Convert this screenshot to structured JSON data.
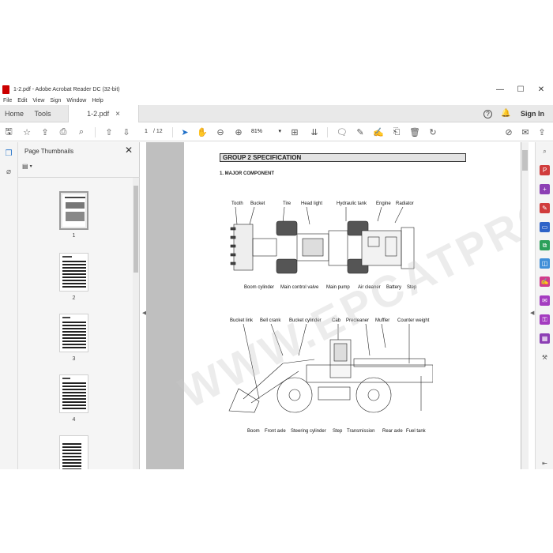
{
  "window": {
    "title": "1-2.pdf - Adobe Acrobat Reader DC (32-bit)",
    "controls": [
      "—",
      "☐",
      "✕"
    ]
  },
  "menu": [
    "File",
    "Edit",
    "View",
    "Sign",
    "Window",
    "Help"
  ],
  "tabs": {
    "home": "Home",
    "tools": "Tools",
    "document": "1-2.pdf",
    "sign_in": "Sign In"
  },
  "toolbar": {
    "current_page": "1",
    "total_pages": "/ 12",
    "zoom": "81%",
    "zoom_arrow": "▾"
  },
  "thumbnails_panel": {
    "title": "Page Thumbnails",
    "pages": [
      "1",
      "2",
      "3",
      "4"
    ]
  },
  "document": {
    "section_header": "GROUP 2  SPECIFICATION",
    "subsection": "1. MAJOR COMPONENT",
    "top_labels_upper": [
      "Tooth",
      "Bucket",
      "Tire",
      "Head light",
      "Hydraulic tank",
      "Engine",
      "Radiator"
    ],
    "top_labels_lower": [
      "Boom cylinder",
      "Main control valve",
      "Main pump",
      "Air cleaner",
      "Battery",
      "Step"
    ],
    "side_labels_upper": [
      "Bucket link",
      "Bell crank",
      "Bucket cylinder",
      "Cab",
      "Precleaner",
      "Muffler",
      "Counter weight"
    ],
    "side_labels_lower": [
      "Boom",
      "Front axle",
      "Steering cylinder",
      "Step",
      "Transmission",
      "Rear axle",
      "Fuel tank"
    ],
    "watermark": "WWW.EPCATPRO.COM"
  },
  "colors": {
    "accent": "#1e6fc8",
    "tab_bar": "#e9e9e9",
    "doc_background": "#bfbfbf"
  }
}
